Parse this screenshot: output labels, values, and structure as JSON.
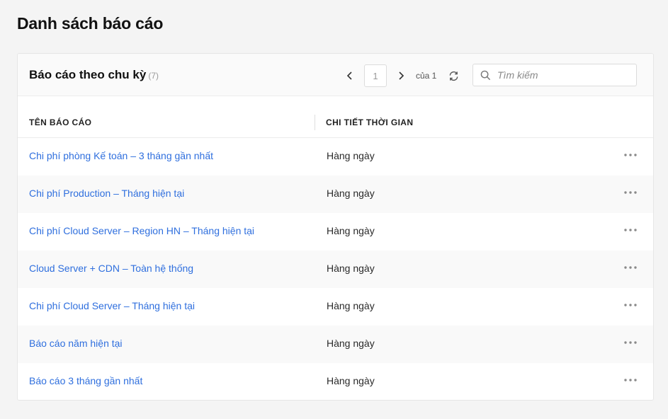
{
  "page": {
    "title": "Danh sách báo cáo"
  },
  "card": {
    "title": "Báo cáo theo chu kỳ",
    "count": "(7)",
    "pager": {
      "current_page": "1",
      "of_label": "của 1"
    },
    "search": {
      "placeholder": "Tìm kiếm",
      "value": ""
    }
  },
  "table": {
    "columns": [
      "TÊN BÁO CÁO",
      "CHI TIẾT THỜI GIAN"
    ],
    "rows": [
      {
        "name": "Chi phí phòng Kế toán – 3 tháng gần nhất",
        "time": "Hàng ngày"
      },
      {
        "name": "Chi phí Production – Tháng hiện tại",
        "time": "Hàng ngày"
      },
      {
        "name": "Chi phí Cloud Server – Region HN – Tháng hiện tại",
        "time": "Hàng ngày"
      },
      {
        "name": "Cloud Server + CDN – Toàn hệ thống",
        "time": "Hàng ngày"
      },
      {
        "name": "Chi phí Cloud Server – Tháng hiện tại",
        "time": "Hàng ngày"
      },
      {
        "name": "Báo cáo năm hiện tại",
        "time": "Hàng ngày"
      },
      {
        "name": "Báo cáo 3 tháng gần nhất",
        "time": "Hàng ngày"
      }
    ]
  },
  "icons": {
    "prev": "chevron-left-icon",
    "next": "chevron-right-icon",
    "refresh": "refresh-icon",
    "search": "search-icon",
    "more": "more-horizontal-icon"
  },
  "colors": {
    "link": "#2f6fde",
    "background": "#f4f4f4",
    "card": "#ffffff"
  }
}
